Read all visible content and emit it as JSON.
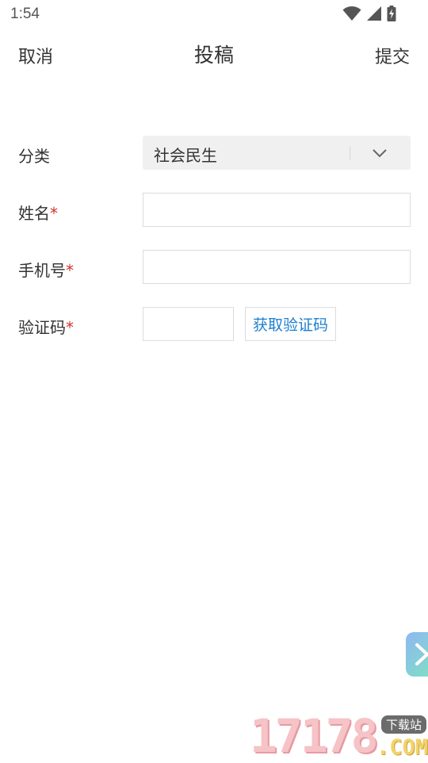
{
  "status_bar": {
    "time": "1:54",
    "icons": [
      "wifi-icon",
      "cell-signal-icon",
      "battery-charging-icon"
    ]
  },
  "nav": {
    "cancel_label": "取消",
    "title": "投稿",
    "submit_label": "提交"
  },
  "form": {
    "category": {
      "label": "分类",
      "selected": "社会民生"
    },
    "name": {
      "label": "姓名",
      "required_mark": "*",
      "value": "",
      "placeholder": ""
    },
    "phone": {
      "label": "手机号",
      "required_mark": "*",
      "value": "",
      "placeholder": ""
    },
    "code": {
      "label": "验证码",
      "required_mark": "*",
      "value": "",
      "placeholder": "",
      "button_label": "获取验证码"
    }
  },
  "watermark": {
    "number": "17178",
    "badge": "下载站",
    "suffix": ".COM"
  },
  "colors": {
    "accent_link": "#1e7fd0",
    "required": "#d0342c",
    "select_bg": "#f0f0f0",
    "border": "#dcdcdc"
  }
}
